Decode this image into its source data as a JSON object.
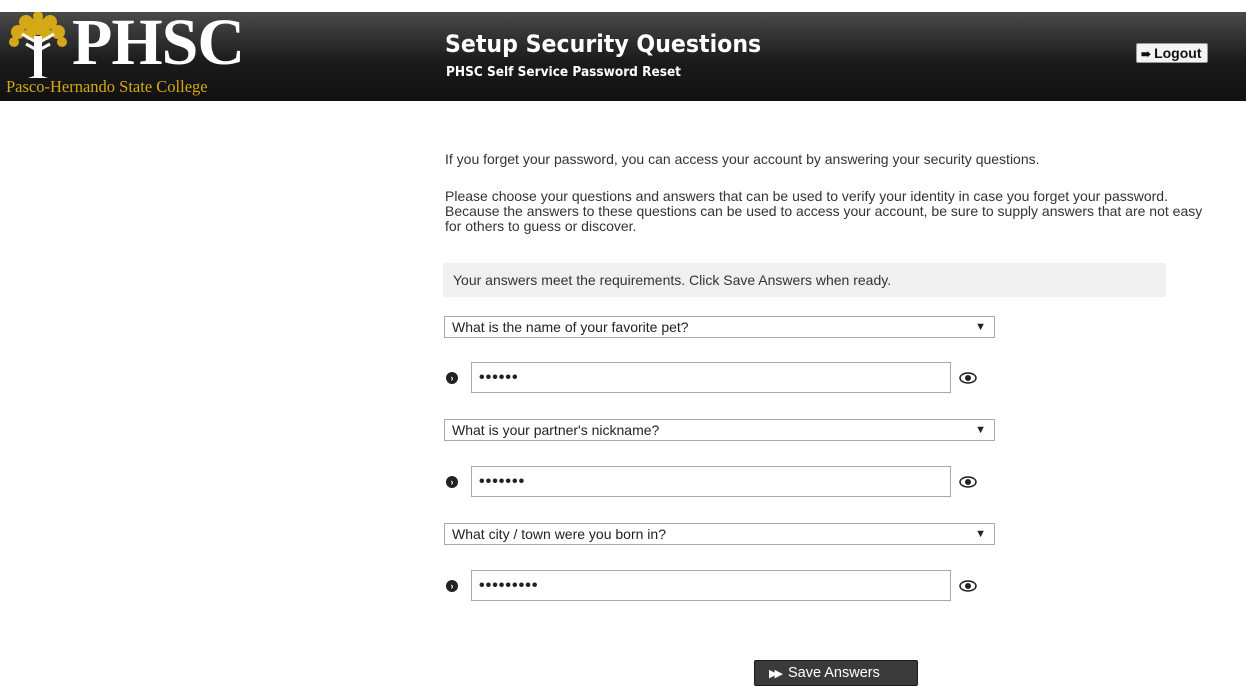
{
  "header": {
    "logo_text": "PHSC",
    "logo_subtext": "Pasco-Hernando State College",
    "title": "Setup Security Questions",
    "subtitle": "PHSC Self Service Password Reset",
    "logout_label": "Logout",
    "logout_icon": "logout-icon"
  },
  "intro": {
    "paragraph1": "If you forget your password, you can access your account by answering your security questions.",
    "paragraph2": "Please choose your questions and answers that can be used to verify your identity in case you forget your password. Because the answers to these questions can be used to access your account, be sure to supply answers that are not easy for others to guess or discover."
  },
  "status_message": "Your answers meet the requirements. Click Save Answers when ready.",
  "questions": [
    {
      "question": "What is the name of your favorite pet?",
      "answer_mask": "••••••"
    },
    {
      "question": "What is your partner's nickname?",
      "answer_mask": "•••••••"
    },
    {
      "question": "What city / town were you born in?",
      "answer_mask": "•••••••••"
    }
  ],
  "save_label": "Save Answers",
  "colors": {
    "header_bg": "#1b1b1b",
    "logo_gold": "#d4a816",
    "button_bg": "#3a3a3a",
    "notice_bg": "#f0f0f0"
  }
}
